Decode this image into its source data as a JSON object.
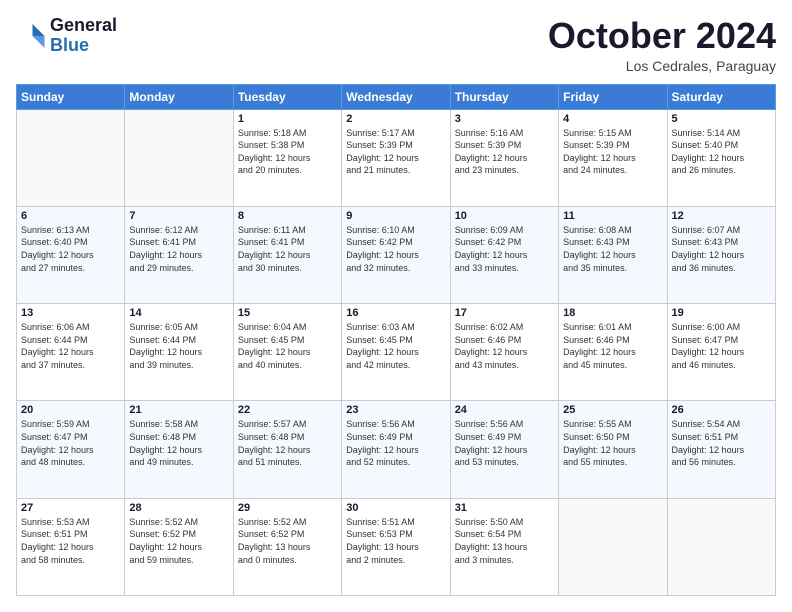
{
  "header": {
    "logo_line1": "General",
    "logo_line2": "Blue",
    "month": "October 2024",
    "location": "Los Cedrales, Paraguay"
  },
  "days_of_week": [
    "Sunday",
    "Monday",
    "Tuesday",
    "Wednesday",
    "Thursday",
    "Friday",
    "Saturday"
  ],
  "weeks": [
    [
      {
        "day": "",
        "info": ""
      },
      {
        "day": "",
        "info": ""
      },
      {
        "day": "1",
        "info": "Sunrise: 5:18 AM\nSunset: 5:38 PM\nDaylight: 12 hours\nand 20 minutes."
      },
      {
        "day": "2",
        "info": "Sunrise: 5:17 AM\nSunset: 5:39 PM\nDaylight: 12 hours\nand 21 minutes."
      },
      {
        "day": "3",
        "info": "Sunrise: 5:16 AM\nSunset: 5:39 PM\nDaylight: 12 hours\nand 23 minutes."
      },
      {
        "day": "4",
        "info": "Sunrise: 5:15 AM\nSunset: 5:39 PM\nDaylight: 12 hours\nand 24 minutes."
      },
      {
        "day": "5",
        "info": "Sunrise: 5:14 AM\nSunset: 5:40 PM\nDaylight: 12 hours\nand 26 minutes."
      }
    ],
    [
      {
        "day": "6",
        "info": "Sunrise: 6:13 AM\nSunset: 6:40 PM\nDaylight: 12 hours\nand 27 minutes."
      },
      {
        "day": "7",
        "info": "Sunrise: 6:12 AM\nSunset: 6:41 PM\nDaylight: 12 hours\nand 29 minutes."
      },
      {
        "day": "8",
        "info": "Sunrise: 6:11 AM\nSunset: 6:41 PM\nDaylight: 12 hours\nand 30 minutes."
      },
      {
        "day": "9",
        "info": "Sunrise: 6:10 AM\nSunset: 6:42 PM\nDaylight: 12 hours\nand 32 minutes."
      },
      {
        "day": "10",
        "info": "Sunrise: 6:09 AM\nSunset: 6:42 PM\nDaylight: 12 hours\nand 33 minutes."
      },
      {
        "day": "11",
        "info": "Sunrise: 6:08 AM\nSunset: 6:43 PM\nDaylight: 12 hours\nand 35 minutes."
      },
      {
        "day": "12",
        "info": "Sunrise: 6:07 AM\nSunset: 6:43 PM\nDaylight: 12 hours\nand 36 minutes."
      }
    ],
    [
      {
        "day": "13",
        "info": "Sunrise: 6:06 AM\nSunset: 6:44 PM\nDaylight: 12 hours\nand 37 minutes."
      },
      {
        "day": "14",
        "info": "Sunrise: 6:05 AM\nSunset: 6:44 PM\nDaylight: 12 hours\nand 39 minutes."
      },
      {
        "day": "15",
        "info": "Sunrise: 6:04 AM\nSunset: 6:45 PM\nDaylight: 12 hours\nand 40 minutes."
      },
      {
        "day": "16",
        "info": "Sunrise: 6:03 AM\nSunset: 6:45 PM\nDaylight: 12 hours\nand 42 minutes."
      },
      {
        "day": "17",
        "info": "Sunrise: 6:02 AM\nSunset: 6:46 PM\nDaylight: 12 hours\nand 43 minutes."
      },
      {
        "day": "18",
        "info": "Sunrise: 6:01 AM\nSunset: 6:46 PM\nDaylight: 12 hours\nand 45 minutes."
      },
      {
        "day": "19",
        "info": "Sunrise: 6:00 AM\nSunset: 6:47 PM\nDaylight: 12 hours\nand 46 minutes."
      }
    ],
    [
      {
        "day": "20",
        "info": "Sunrise: 5:59 AM\nSunset: 6:47 PM\nDaylight: 12 hours\nand 48 minutes."
      },
      {
        "day": "21",
        "info": "Sunrise: 5:58 AM\nSunset: 6:48 PM\nDaylight: 12 hours\nand 49 minutes."
      },
      {
        "day": "22",
        "info": "Sunrise: 5:57 AM\nSunset: 6:48 PM\nDaylight: 12 hours\nand 51 minutes."
      },
      {
        "day": "23",
        "info": "Sunrise: 5:56 AM\nSunset: 6:49 PM\nDaylight: 12 hours\nand 52 minutes."
      },
      {
        "day": "24",
        "info": "Sunrise: 5:56 AM\nSunset: 6:49 PM\nDaylight: 12 hours\nand 53 minutes."
      },
      {
        "day": "25",
        "info": "Sunrise: 5:55 AM\nSunset: 6:50 PM\nDaylight: 12 hours\nand 55 minutes."
      },
      {
        "day": "26",
        "info": "Sunrise: 5:54 AM\nSunset: 6:51 PM\nDaylight: 12 hours\nand 56 minutes."
      }
    ],
    [
      {
        "day": "27",
        "info": "Sunrise: 5:53 AM\nSunset: 6:51 PM\nDaylight: 12 hours\nand 58 minutes."
      },
      {
        "day": "28",
        "info": "Sunrise: 5:52 AM\nSunset: 6:52 PM\nDaylight: 12 hours\nand 59 minutes."
      },
      {
        "day": "29",
        "info": "Sunrise: 5:52 AM\nSunset: 6:52 PM\nDaylight: 13 hours\nand 0 minutes."
      },
      {
        "day": "30",
        "info": "Sunrise: 5:51 AM\nSunset: 6:53 PM\nDaylight: 13 hours\nand 2 minutes."
      },
      {
        "day": "31",
        "info": "Sunrise: 5:50 AM\nSunset: 6:54 PM\nDaylight: 13 hours\nand 3 minutes."
      },
      {
        "day": "",
        "info": ""
      },
      {
        "day": "",
        "info": ""
      }
    ]
  ]
}
